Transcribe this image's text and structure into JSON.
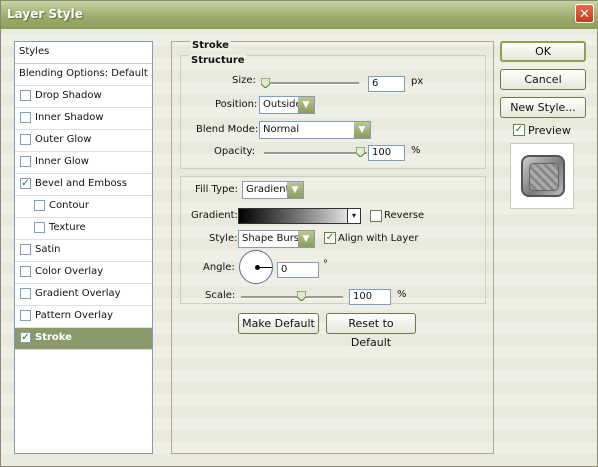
{
  "window": {
    "title": "Layer Style",
    "close_symbol": "✕"
  },
  "sidebar": {
    "heading": "Styles",
    "blending": "Blending Options: Default",
    "items": [
      {
        "label": "Drop Shadow",
        "checked": false,
        "indent": false,
        "selected": false
      },
      {
        "label": "Inner Shadow",
        "checked": false,
        "indent": false,
        "selected": false
      },
      {
        "label": "Outer Glow",
        "checked": false,
        "indent": false,
        "selected": false
      },
      {
        "label": "Inner Glow",
        "checked": false,
        "indent": false,
        "selected": false
      },
      {
        "label": "Bevel and Emboss",
        "checked": true,
        "indent": false,
        "selected": false
      },
      {
        "label": "Contour",
        "checked": false,
        "indent": true,
        "selected": false
      },
      {
        "label": "Texture",
        "checked": false,
        "indent": true,
        "selected": false
      },
      {
        "label": "Satin",
        "checked": false,
        "indent": false,
        "selected": false
      },
      {
        "label": "Color Overlay",
        "checked": false,
        "indent": false,
        "selected": false
      },
      {
        "label": "Gradient Overlay",
        "checked": false,
        "indent": false,
        "selected": false
      },
      {
        "label": "Pattern Overlay",
        "checked": false,
        "indent": false,
        "selected": false
      },
      {
        "label": "Stroke",
        "checked": true,
        "indent": false,
        "selected": true
      }
    ]
  },
  "stroke": {
    "title": "Stroke",
    "structure_title": "Structure",
    "size_label": "Size:",
    "size_value": "6",
    "size_unit": "px",
    "position_label": "Position:",
    "position_value": "Outside",
    "blend_label": "Blend Mode:",
    "blend_value": "Normal",
    "opacity_label": "Opacity:",
    "opacity_value": "100",
    "opacity_unit": "%",
    "fill_type_label": "Fill Type:",
    "fill_type_value": "Gradient",
    "gradient_label": "Gradient:",
    "reverse_label": "Reverse",
    "reverse_checked": false,
    "style_label": "Style:",
    "style_value": "Shape Burst",
    "align_label": "Align with Layer",
    "align_checked": true,
    "angle_label": "Angle:",
    "angle_value": "0",
    "angle_unit": "°",
    "scale_label": "Scale:",
    "scale_value": "100",
    "scale_unit": "%",
    "make_default": "Make Default",
    "reset_default": "Reset to Default"
  },
  "actions": {
    "ok": "OK",
    "cancel": "Cancel",
    "new_style": "New Style...",
    "preview_label": "Preview",
    "preview_checked": true
  },
  "colors": {
    "accent": "#8a9a6b",
    "titlebar": "#9fae6f"
  },
  "icons": {
    "check": "✓",
    "dropdown": "▼",
    "gradient_dropdown": "▾"
  }
}
